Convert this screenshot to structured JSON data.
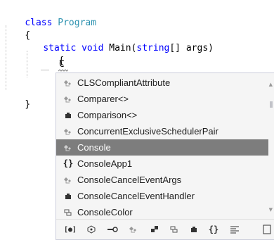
{
  "code": {
    "line1_kw": "class",
    "line1_name": "Program",
    "line2": "{",
    "line3_static": "static",
    "line3_void": "void",
    "line3_main": "Main(",
    "line3_string": "string",
    "line3_args": "[] args)",
    "line4": "{",
    "line5_typed": "C",
    "line6": "}",
    "line7": "}"
  },
  "completion": {
    "items": [
      {
        "label": "CLSCompliantAttribute",
        "icon": "class-icon"
      },
      {
        "label": "Comparer<>",
        "icon": "class-icon"
      },
      {
        "label": "Comparison<>",
        "icon": "delegate-icon"
      },
      {
        "label": "ConcurrentExclusiveSchedulerPair",
        "icon": "class-icon"
      },
      {
        "label": "Console",
        "icon": "class-icon",
        "selected": true
      },
      {
        "label": "ConsoleApp1",
        "icon": "namespace-icon"
      },
      {
        "label": "ConsoleCancelEventArgs",
        "icon": "class-icon"
      },
      {
        "label": "ConsoleCancelEventHandler",
        "icon": "delegate-icon"
      },
      {
        "label": "ConsoleColor",
        "icon": "enum-icon"
      }
    ],
    "filters": [
      "filter-locals-icon",
      "filter-interfaces-icon",
      "filter-properties-icon",
      "filter-classes-icon",
      "filter-structs-icon",
      "filter-enums-icon",
      "filter-delegates-icon",
      "filter-namespaces-icon",
      "filter-keywords-icon",
      "filter-snippets-icon"
    ]
  },
  "colors": {
    "keyword": "#0000ff",
    "type": "#2b91af",
    "selection": "#7d7d7d",
    "class_icon": "#8a8a8a",
    "popup_bg": "#f5f5f5"
  }
}
